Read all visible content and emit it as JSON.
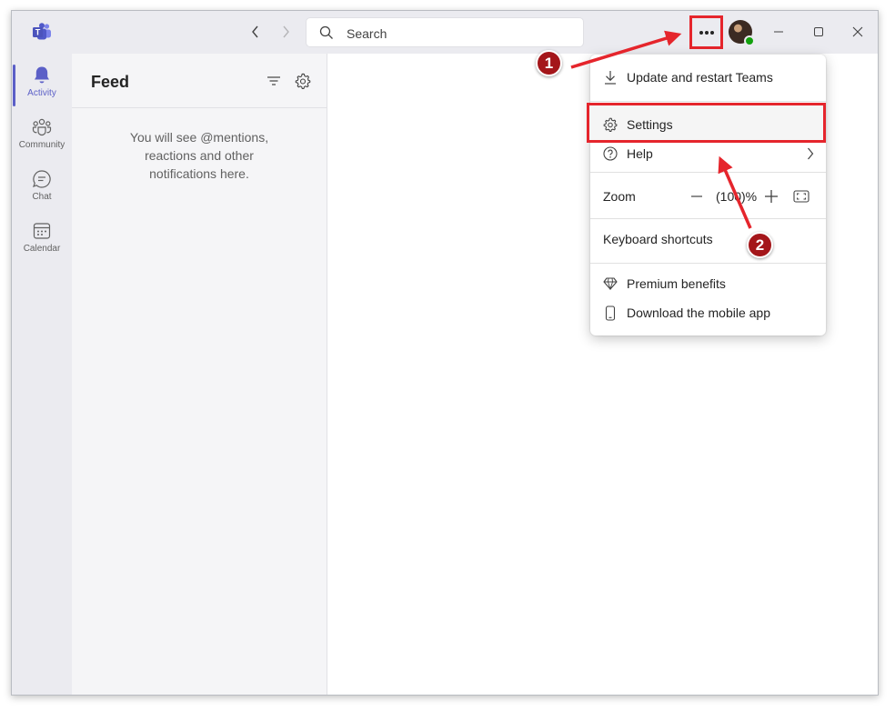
{
  "titlebar": {
    "search_placeholder": "Search",
    "more_icon": "more-horizontal-icon",
    "status_color": "#13a10e"
  },
  "rail": {
    "items": [
      {
        "label": "Activity",
        "icon": "bell-icon",
        "active": true
      },
      {
        "label": "Community",
        "icon": "community-icon",
        "active": false
      },
      {
        "label": "Chat",
        "icon": "chat-icon",
        "active": false
      },
      {
        "label": "Calendar",
        "icon": "calendar-icon",
        "active": false
      }
    ],
    "accent": "#5b5fc7"
  },
  "feed": {
    "title": "Feed",
    "empty_lines": [
      "You will see @mentions,",
      "reactions and other",
      "notifications here."
    ]
  },
  "menu": {
    "update": "Update and restart Teams",
    "settings": "Settings",
    "help": "Help",
    "zoom_label": "Zoom",
    "zoom_value": "(100)%",
    "keyboard": "Keyboard shortcuts",
    "premium": "Premium benefits",
    "download": "Download the mobile app"
  },
  "annotations": {
    "step1": "1",
    "step2": "2",
    "highlight_color": "#e5252c",
    "badge_color": "#a4161a"
  }
}
